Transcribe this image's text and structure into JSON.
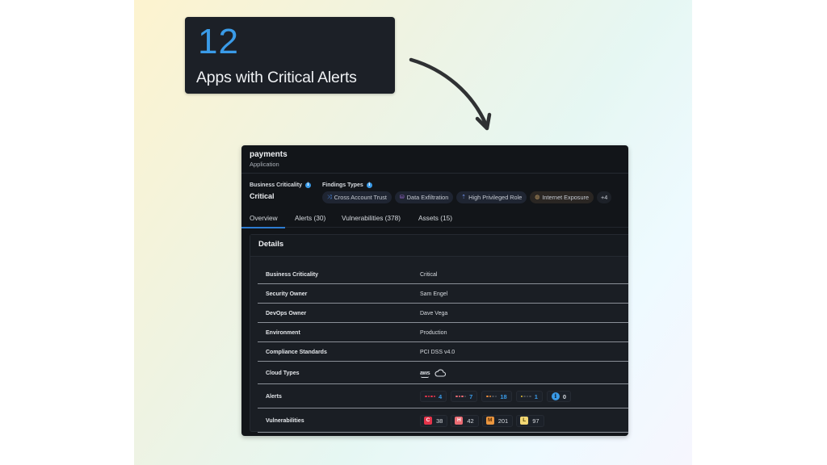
{
  "stat_card": {
    "value": "12",
    "label": "Apps with Critical Alerts",
    "value_color": "#3a9be8"
  },
  "app": {
    "title": "payments",
    "subtitle": "Application",
    "business_criticality": {
      "label": "Business Criticality",
      "value": "Critical",
      "info_icon": "info-icon"
    },
    "findings_types": {
      "label": "Findings Types",
      "info_icon": "info-icon",
      "chips": [
        {
          "label": "Cross Account Trust",
          "icon": "shuffle-icon",
          "icon_color": "#4d8de6"
        },
        {
          "label": "Data Exfiltration",
          "icon": "database-icon",
          "icon_color": "#a66fe0"
        },
        {
          "label": "High Privileged Role",
          "icon": "privilege-icon",
          "icon_color": "#6f8fe6"
        },
        {
          "label": "Internet Exposure",
          "icon": "globe-icon",
          "icon_color": "#c9a36a"
        }
      ],
      "more": "+4"
    },
    "tabs": [
      {
        "label": "Overview",
        "active": true
      },
      {
        "label": "Alerts (30)",
        "active": false
      },
      {
        "label": "Vulnerabilities (378)",
        "active": false
      },
      {
        "label": "Assets (15)",
        "active": false
      }
    ],
    "details": {
      "title": "Details",
      "rows": [
        {
          "label": "Business Criticality",
          "value": "Critical"
        },
        {
          "label": "Security Owner",
          "value": "Sam Engel"
        },
        {
          "label": "DevOps Owner",
          "value": "Dave Vega"
        },
        {
          "label": "Environment",
          "value": "Production"
        },
        {
          "label": "Compliance Standards",
          "value": "PCI DSS v4.0"
        },
        {
          "label": "Cloud Types",
          "icons": [
            "aws-logo",
            "cloud-icon"
          ],
          "aws_text": "aws"
        },
        {
          "label": "Alerts"
        },
        {
          "label": "Vulnerabilities"
        }
      ],
      "alerts": [
        {
          "severity": "critical",
          "count": "4",
          "color": "#e5344a",
          "filled": 4
        },
        {
          "severity": "high",
          "count": "7",
          "color": "#ea6b73",
          "filled": 3
        },
        {
          "severity": "medium",
          "count": "18",
          "color": "#e88a3a",
          "filled": 2
        },
        {
          "severity": "low",
          "count": "1",
          "color": "#e6c13a",
          "filled": 1
        },
        {
          "severity": "info",
          "count": "0",
          "color": "#3a9be8",
          "icon": "i"
        }
      ],
      "vulnerabilities": [
        {
          "letter": "C",
          "count": "38",
          "color": "#e5344a",
          "text": "#ffffff"
        },
        {
          "letter": "H",
          "count": "42",
          "color": "#ea6b73",
          "text": "#ffffff"
        },
        {
          "letter": "M",
          "count": "201",
          "color": "#eb963f",
          "text": "#5a2e05"
        },
        {
          "letter": "L",
          "count": "97",
          "color": "#f2d774",
          "text": "#5a4805"
        }
      ]
    }
  }
}
